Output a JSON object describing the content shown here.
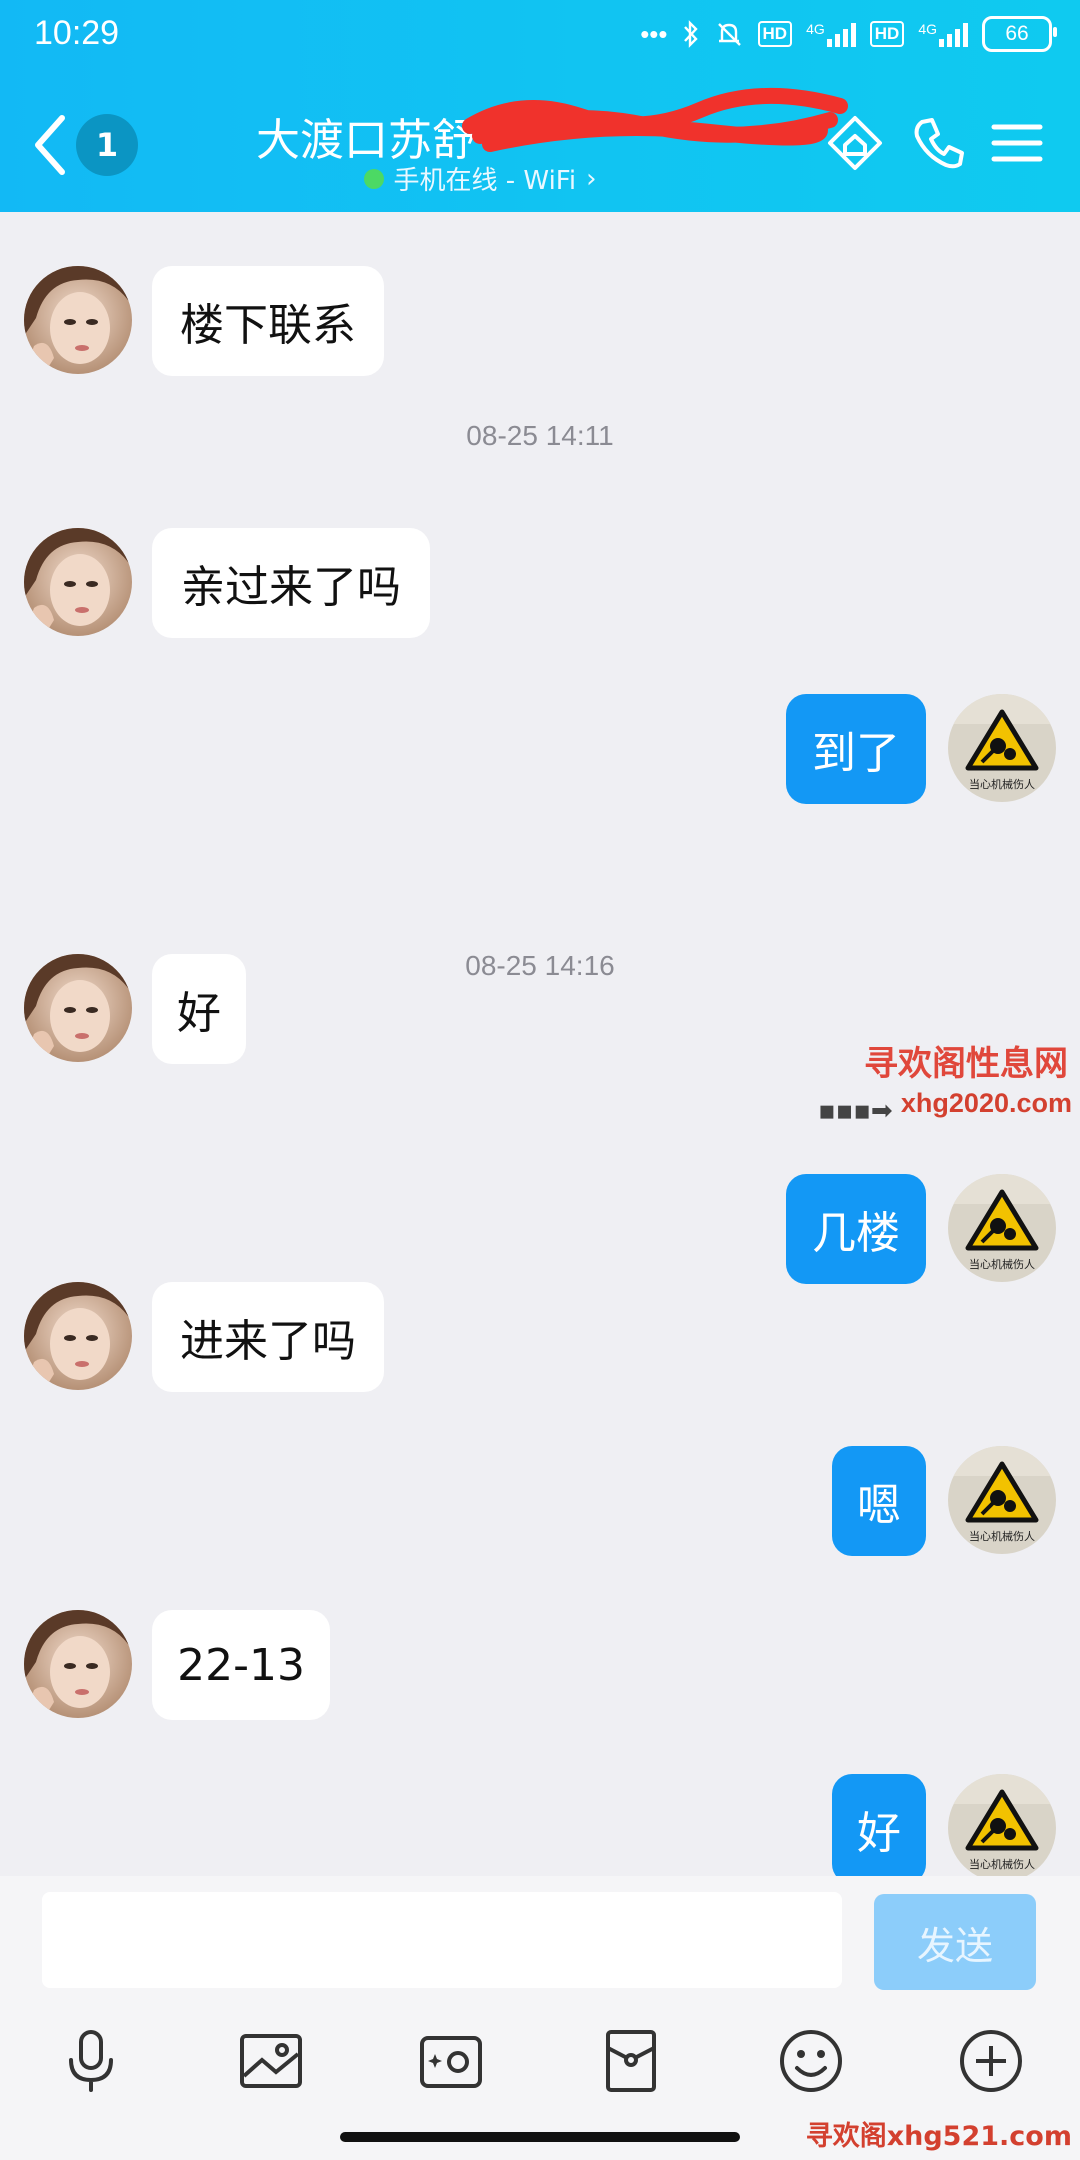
{
  "status_bar": {
    "time": "10:29",
    "signal_1": "4G",
    "signal_2": "4G",
    "hd_1": "HD",
    "hd_2": "HD",
    "battery": "66"
  },
  "header": {
    "unread_count": "1",
    "title": "大渡口苏舒",
    "status": "手机在线 - WiFi",
    "status_chevron": "›"
  },
  "messages": [
    {
      "side": "in",
      "text": "楼下联系"
    },
    {
      "type": "timestamp",
      "text": "08-25 14:11"
    },
    {
      "side": "in",
      "text": "亲过来了吗"
    },
    {
      "side": "out",
      "text": "到了"
    },
    {
      "type": "timestamp",
      "text": "08-25 14:16"
    },
    {
      "side": "in",
      "text": "好"
    },
    {
      "side": "out",
      "text": "几楼"
    },
    {
      "side": "in",
      "text": "进来了吗"
    },
    {
      "side": "out",
      "text": "嗯"
    },
    {
      "side": "in",
      "text": "22-13"
    },
    {
      "side": "out",
      "text": "好"
    }
  ],
  "sign_caption": "当心机械伤人",
  "composer": {
    "placeholder": "",
    "send_label": "发送"
  },
  "toolbar": [
    "microphone-icon",
    "image-icon",
    "camera-icon",
    "red-packet-icon",
    "emoji-icon",
    "plus-icon"
  ],
  "watermark": {
    "line1": "寻欢阁性息网",
    "arrow": "▪▪▪➡",
    "line2": "xhg2020.com",
    "bottom": "寻欢阁xhg521.com"
  },
  "colors": {
    "header": "#12b9f5",
    "outgoing_bubble": "#1398f5",
    "incoming_bubble": "#ffffff",
    "background": "#efeff3",
    "send_disabled": "#8ccdfa"
  }
}
